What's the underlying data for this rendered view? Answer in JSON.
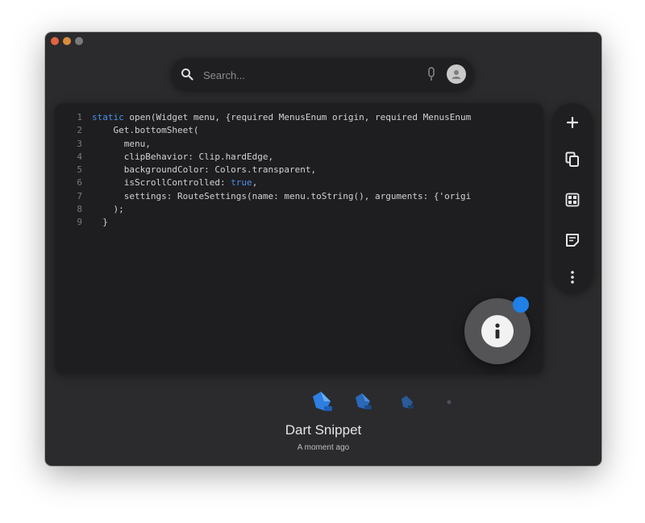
{
  "window": {
    "controls": [
      "close",
      "minimize",
      "maximize"
    ]
  },
  "search": {
    "placeholder": "Search...",
    "value": "",
    "icon": "search-icon",
    "mic_icon": "mic-icon"
  },
  "code": {
    "language": "Dart",
    "lines": [
      {
        "no": "1",
        "kw": "static",
        "text": " open(Widget menu, {required MenusEnum origin, required MenusEnum"
      },
      {
        "no": "2",
        "kw": "",
        "text": "    Get.bottomSheet("
      },
      {
        "no": "3",
        "kw": "",
        "text": "      menu,"
      },
      {
        "no": "4",
        "kw": "",
        "text": "      clipBehavior: Clip.hardEdge,"
      },
      {
        "no": "5",
        "kw": "",
        "text": "      backgroundColor: Colors.transparent,"
      },
      {
        "no": "6",
        "kw": "",
        "text": "      isScrollControlled: ",
        "kw_after": "true",
        "after": ","
      },
      {
        "no": "7",
        "kw": "",
        "text": "      settings: RouteSettings(name: menu.toString(), arguments: {'origi"
      },
      {
        "no": "8",
        "kw": "",
        "text": "    );"
      },
      {
        "no": "9",
        "kw": "",
        "text": "  }"
      }
    ]
  },
  "toolbar": {
    "items": [
      {
        "name": "add-button",
        "icon": "plus-icon"
      },
      {
        "name": "copy-button",
        "icon": "copy-icon"
      },
      {
        "name": "grid-button",
        "icon": "grid-icon"
      },
      {
        "name": "note-button",
        "icon": "note-icon"
      },
      {
        "name": "more-button",
        "icon": "more-vertical-icon"
      }
    ]
  },
  "info_button": {
    "icon": "info-icon",
    "badge_color": "#1f80e8"
  },
  "snippet": {
    "title": "Dart Snippet",
    "time": "A moment ago"
  },
  "colors": {
    "window_bg": "#2b2b2d",
    "card_bg": "#1e1e20",
    "accent": "#1f80e8",
    "keyword": "#4d8fe8"
  }
}
